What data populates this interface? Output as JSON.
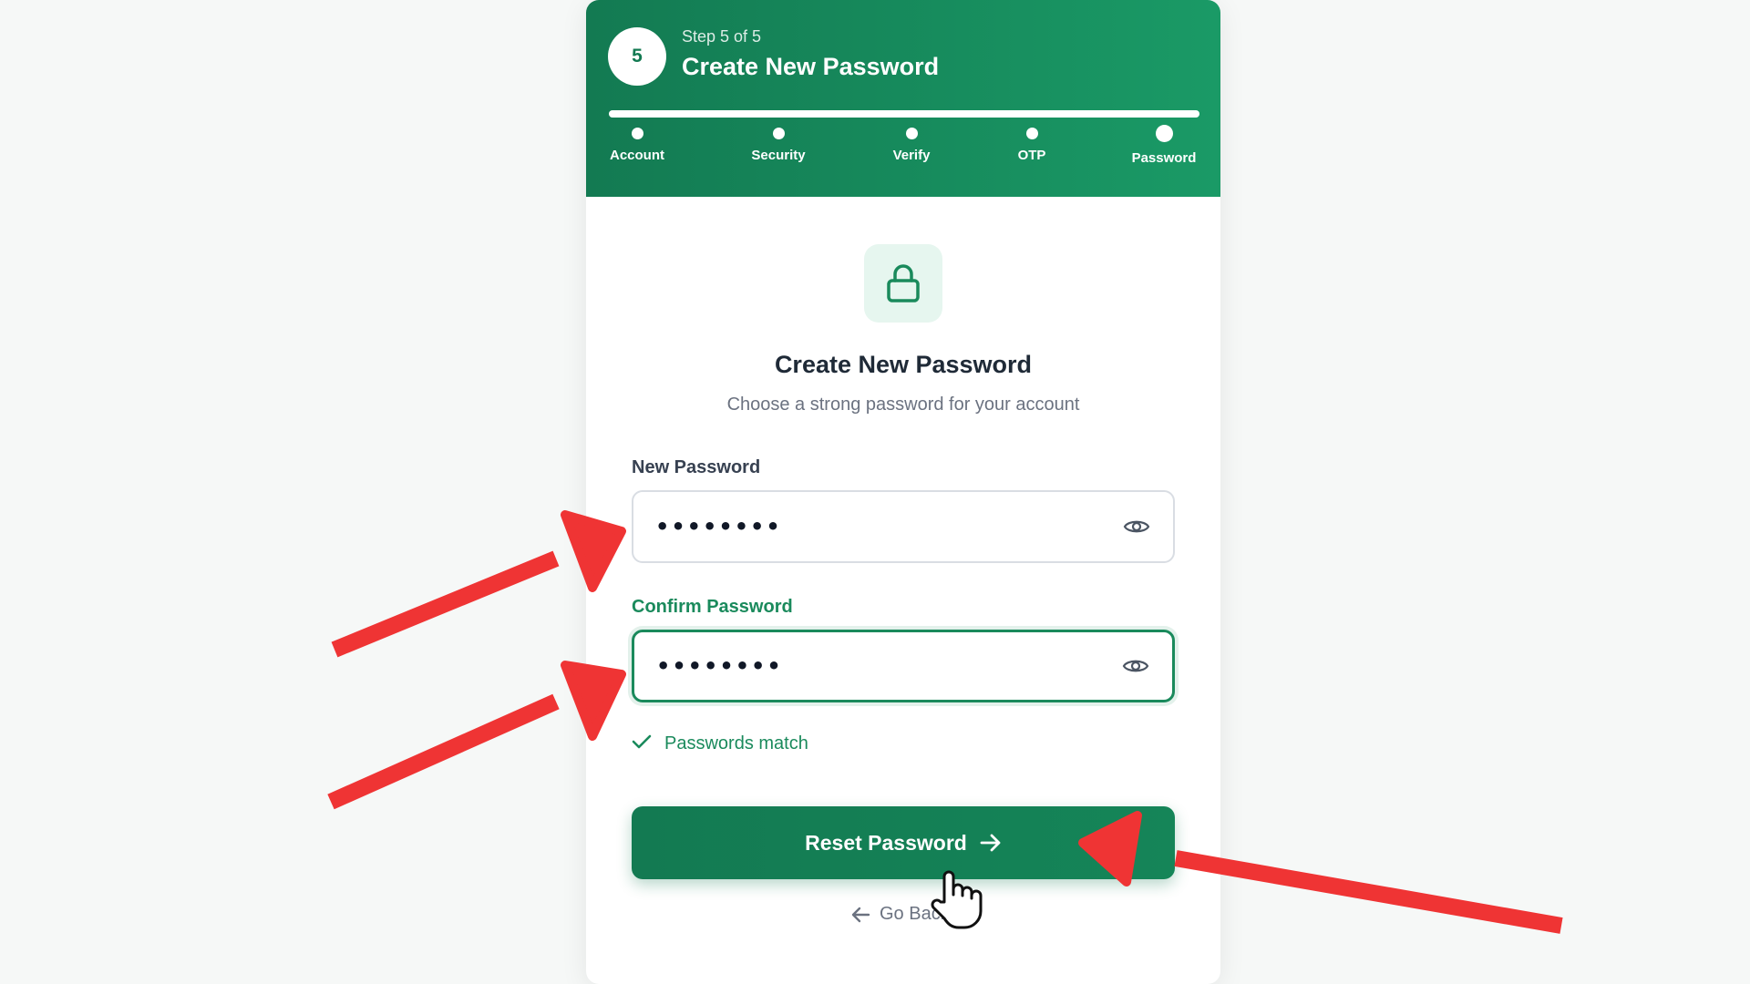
{
  "header": {
    "step_number": "5",
    "step_of": "Step 5 of 5",
    "title": "Create New Password",
    "progress_fraction": 1.0,
    "steps": [
      {
        "label": "Account",
        "active": false
      },
      {
        "label": "Security",
        "active": false
      },
      {
        "label": "Verify",
        "active": false
      },
      {
        "label": "OTP",
        "active": false
      },
      {
        "label": "Password",
        "active": true
      }
    ]
  },
  "content": {
    "icon": "lock-icon",
    "title": "Create New Password",
    "subtitle": "Choose a strong password for your account"
  },
  "form": {
    "new_password": {
      "label": "New Password",
      "value": "••••••••",
      "icon": "eye-icon"
    },
    "confirm_password": {
      "label": "Confirm Password",
      "value": "••••••••",
      "icon": "eye-icon"
    },
    "match_status": "Passwords match",
    "submit_label": "Reset Password",
    "back_label": "Go Back"
  },
  "colors": {
    "brand": "#137a52",
    "brand_light": "#1a9a66",
    "success": "#1a8a5c",
    "annotation": "#ef3434"
  }
}
